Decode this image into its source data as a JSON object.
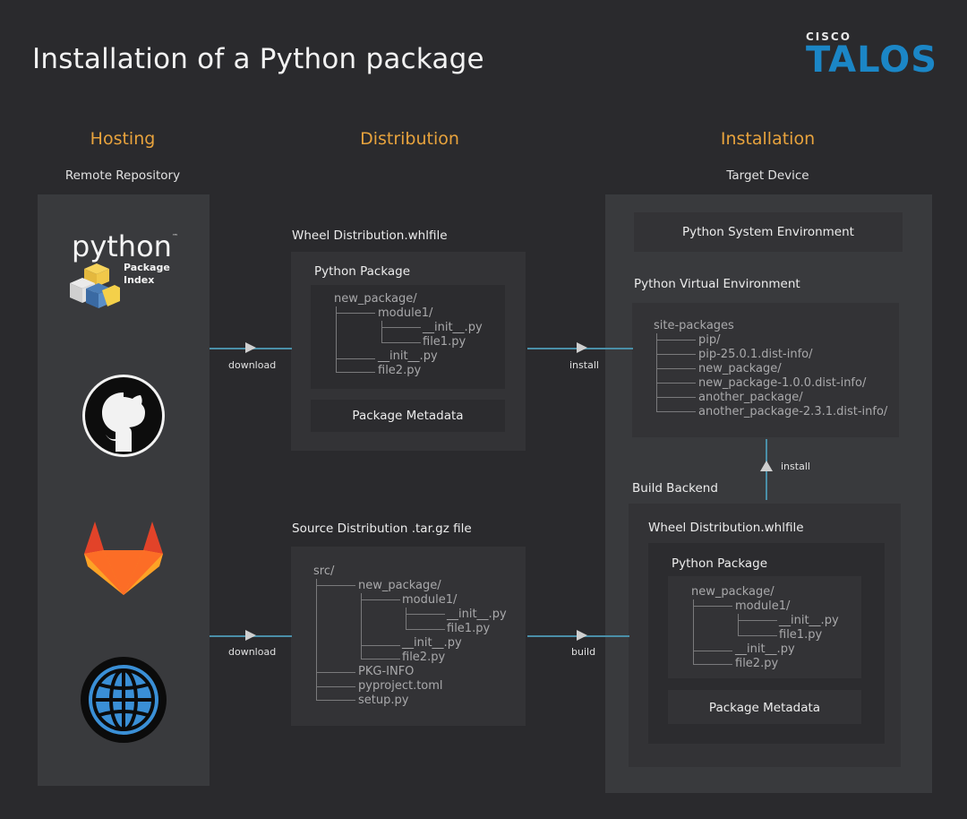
{
  "title": "Installation of a Python package",
  "logo": {
    "small": "CISCO",
    "big": "TALOS"
  },
  "columns": {
    "hosting": {
      "head": "Hosting",
      "sub": "Remote Repository"
    },
    "distribution": {
      "head": "Distribution"
    },
    "installation": {
      "head": "Installation",
      "sub": "Target Device"
    }
  },
  "pypi": {
    "word": "python",
    "tm": "™",
    "line1": "Package",
    "line2": "Index"
  },
  "icons": [
    "python-package-index-logo",
    "github-icon",
    "gitlab-icon",
    "globe-icon"
  ],
  "wheel": {
    "label": "Wheel Distribution.whlfile",
    "pkg_label": "Python Package",
    "tree": [
      "new_package/",
      "module1/",
      "__init__.py",
      "file1.py",
      "__init__.py",
      "file2.py"
    ],
    "meta": "Package Metadata"
  },
  "sdist": {
    "label": "Source Distribution .tar.gz file",
    "tree": [
      "src/",
      "new_package/",
      "module1/",
      "__init__.py",
      "file1.py",
      "__init__.py",
      "file2.py",
      "PKG-INFO",
      "pyproject.toml",
      "setup.py"
    ]
  },
  "target": {
    "system_env": "Python System Environment",
    "venv_label": "Python Virtual Environment",
    "site_tree": [
      "site-packages",
      "pip/",
      "pip-25.0.1.dist-info/",
      "new_package/",
      "new_package-1.0.0.dist-info/",
      "another_package/",
      "another_package-2.3.1.dist-info/"
    ],
    "build_backend": "Build Backend",
    "wheel_label": "Wheel Distribution.whlfile",
    "pkg_label": "Python Package",
    "tree": [
      "new_package/",
      "module1/",
      "__init__.py",
      "file1.py",
      "__init__.py",
      "file2.py"
    ],
    "meta": "Package Metadata"
  },
  "arrows": {
    "download1": "download",
    "install1": "install",
    "download2": "download",
    "build": "build",
    "install2": "install"
  },
  "colors": {
    "accent_orange": "#e8a33d",
    "talos_blue": "#1b86c6",
    "arrow_line": "#4a8fa8"
  }
}
